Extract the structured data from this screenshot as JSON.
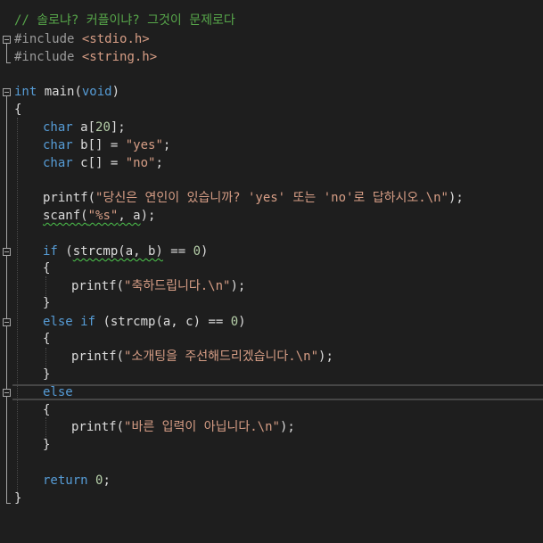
{
  "editor": {
    "lines": {
      "l1": {
        "comment": "// 솔로냐? 커플이냐? 그것이 문제로다"
      },
      "l2": {
        "directive": "#include",
        "header": "<stdio.h>"
      },
      "l3": {
        "directive": "#include",
        "header": "<string.h>"
      },
      "l5": {
        "type": "int",
        "rest": " main(",
        "param": "void",
        "close": ")"
      },
      "l6": {
        "text": "{"
      },
      "l7": {
        "type": "char",
        "rest": " a[",
        "num": "20",
        "close": "];"
      },
      "l8": {
        "type": "char",
        "rest": " b[] = ",
        "str": "\"yes\"",
        "close": ";"
      },
      "l9": {
        "type": "char",
        "rest": " c[] = ",
        "str": "\"no\"",
        "close": ";"
      },
      "l11": {
        "fn": "printf(",
        "str": "\"당신은 연인이 있습니까? 'yes' 또는 'no'로 답하시오.\\n\"",
        "close": ");"
      },
      "l12": {
        "fn": "scanf",
        "open": "(",
        "str": "\"%s\"",
        "rest": ", a",
        "close": ");"
      },
      "l14": {
        "kw": "if",
        "open": " (",
        "call": "strcmp(a, b)",
        "rest": " == ",
        "num": "0",
        "close": ")"
      },
      "l15": {
        "text": "{"
      },
      "l16": {
        "fn": "printf(",
        "str": "\"축하드립니다.\\n\"",
        "close": ");"
      },
      "l17": {
        "text": "}"
      },
      "l18": {
        "kw": "else if",
        "rest": " (strcmp(a, c) == ",
        "num": "0",
        "close": ")"
      },
      "l19": {
        "text": "{"
      },
      "l20": {
        "fn": "printf(",
        "str": "\"소개팅을 주선해드리겠습니다.\\n\"",
        "close": ");"
      },
      "l21": {
        "text": "}"
      },
      "l22": {
        "kw": "else"
      },
      "l23": {
        "text": "{"
      },
      "l24": {
        "fn": "printf(",
        "str": "\"바른 입력이 아닙니다.\\n\"",
        "close": ");"
      },
      "l25": {
        "text": "}"
      },
      "l27": {
        "kw": "return",
        "rest": " ",
        "num": "0",
        "close": ";"
      },
      "l28": {
        "text": "}"
      }
    }
  },
  "colors": {
    "background": "#1e1e1e",
    "keyword": "#569cd6",
    "string": "#d69d85",
    "comment": "#57a64a",
    "number": "#b5cea8",
    "squiggle": "#4ec94e"
  }
}
